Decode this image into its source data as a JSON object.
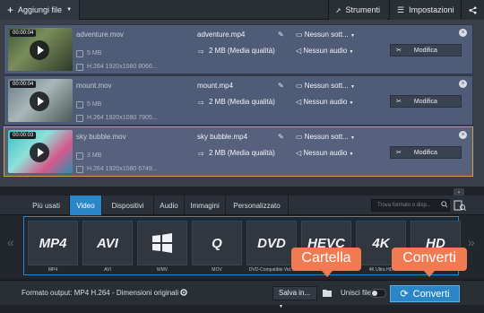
{
  "toolbar": {
    "add_files": "Aggiungi file",
    "tools": "Strumenti",
    "settings": "Impostazioni"
  },
  "files": [
    {
      "duration": "00:00:04",
      "source_name": "adventure.mov",
      "source_size": "5 MB",
      "source_codec": "H.264 1920x1080 8066...",
      "output_name": "adventure.mp4",
      "output_size": "2 MB (Media qualità)",
      "subtitles": "Nessun sott...",
      "audio": "Nessun audio",
      "edit_label": "Modifica",
      "selected": false
    },
    {
      "duration": "00:00:04",
      "source_name": "mount.mov",
      "source_size": "5 MB",
      "source_codec": "H.264 1920x1080 7905...",
      "output_name": "mount.mp4",
      "output_size": "2 MB (Media qualità)",
      "subtitles": "Nessun sott...",
      "audio": "Nessun audio",
      "edit_label": "Modifica",
      "selected": false
    },
    {
      "duration": "00:00:03",
      "source_name": "sky bubble.mov",
      "source_size": "3 MB",
      "source_codec": "H.264 1920x1080 6749...",
      "output_name": "sky bubble.mp4",
      "output_size": "2 MB (Media qualità)",
      "subtitles": "Nessun sott...",
      "audio": "Nessun audio",
      "edit_label": "Modifica",
      "selected": true
    }
  ],
  "tabs": [
    "Più usati",
    "Video",
    "Dispositivi",
    "Audio",
    "Immagini",
    "Personalizzato"
  ],
  "active_tab": "Video",
  "search": {
    "placeholder": "Trova formato o disp..."
  },
  "formats": [
    {
      "logo": "MP4",
      "label": "MP4"
    },
    {
      "logo": "AVI",
      "label": "AVI"
    },
    {
      "logo": "",
      "label": "WMV"
    },
    {
      "logo": "Q",
      "label": "MOV"
    },
    {
      "logo": "DVD",
      "label": "DVD-Compatible Vid..."
    },
    {
      "logo": "HEVC",
      "label": ""
    },
    {
      "logo": "4K",
      "label": "4K Ultra HD"
    },
    {
      "logo": "HD",
      "label": ""
    }
  ],
  "bottom": {
    "output_format": "Formato output: MP4 H.264 - Dimensioni originali",
    "save_to": "Salva in...",
    "merge": "Unisci file",
    "convert": "Converti"
  },
  "callouts": {
    "folder": "Cartella",
    "convert": "Converti"
  },
  "colors": {
    "accent": "#2b86c8",
    "selected_border": "#c9a14a",
    "callout": "#f07a52"
  }
}
